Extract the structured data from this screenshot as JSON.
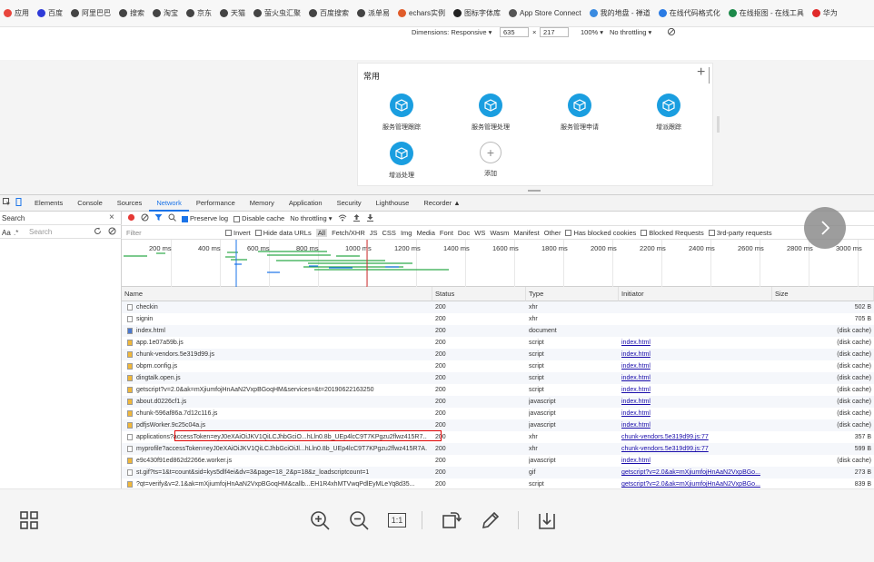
{
  "bookmarks": [
    {
      "label": "应用",
      "icon": "apps-grid-icon",
      "color": "#e8453c"
    },
    {
      "label": "百度",
      "icon": "baidu-paw-icon",
      "color": "#2f3bd8"
    },
    {
      "label": "阿里巴巴",
      "icon": "globe-icon",
      "color": "#444444"
    },
    {
      "label": "搜索",
      "icon": "globe-icon",
      "color": "#444444"
    },
    {
      "label": "淘宝",
      "icon": "globe-icon",
      "color": "#444444"
    },
    {
      "label": "京东",
      "icon": "globe-icon",
      "color": "#444444"
    },
    {
      "label": "天猫",
      "icon": "globe-icon",
      "color": "#444444"
    },
    {
      "label": "萤火虫汇聚",
      "icon": "globe-icon",
      "color": "#444444"
    },
    {
      "label": "百度搜索",
      "icon": "globe-icon",
      "color": "#444444"
    },
    {
      "label": "派单易",
      "icon": "globe-icon",
      "color": "#444444"
    },
    {
      "label": "echars实例",
      "icon": "echarts-icon",
      "color": "#e05c2a"
    },
    {
      "label": "图标字体库",
      "icon": "iconfont-icon",
      "color": "#222222"
    },
    {
      "label": "App Store Connect",
      "icon": "apple-icon",
      "color": "#555555"
    },
    {
      "label": "我的地盘 - 禅道",
      "icon": "zentao-icon",
      "color": "#3a8be0"
    },
    {
      "label": "在线代码格式化",
      "icon": "code-format-icon",
      "color": "#2a7be4"
    },
    {
      "label": "在线抠图 - 在线工具",
      "icon": "tool-icon",
      "color": "#1d8a4a"
    },
    {
      "label": "华为",
      "icon": "huawei-icon",
      "color": "#e02a2a"
    }
  ],
  "device": {
    "dimensions_label": "Dimensions: Responsive ▾",
    "width": "635",
    "times": "×",
    "height": "217",
    "zoom": "100% ▾",
    "throttle": "No throttling ▾"
  },
  "card": {
    "title": "常用",
    "add_symbol": "+",
    "apps": [
      {
        "label": "服务管理跟踪"
      },
      {
        "label": "服务管理处理"
      },
      {
        "label": "服务管理申请"
      },
      {
        "label": "增派跟踪"
      },
      {
        "label": "增派处理"
      }
    ],
    "add_label": "添加"
  },
  "devtools": {
    "tabs": [
      "Elements",
      "Console",
      "Sources",
      "Network",
      "Performance",
      "Memory",
      "Application",
      "Security",
      "Lighthouse",
      "Recorder ▲"
    ],
    "active_tab": "Network",
    "search_label": "Search",
    "search_placeholder": "Search",
    "aa_label": "Aa",
    "regex_label": ".*",
    "preserve_log": "Preserve log",
    "disable_cache": "Disable cache",
    "throttling": "No throttling ▾",
    "filter_placeholder": "Filter",
    "invert": "Invert",
    "hide_data_urls": "Hide data URLs",
    "type_filters": [
      "All",
      "Fetch/XHR",
      "JS",
      "CSS",
      "Img",
      "Media",
      "Font",
      "Doc",
      "WS",
      "Wasm",
      "Manifest",
      "Other"
    ],
    "blocked_cookies": "Has blocked cookies",
    "blocked_requests": "Blocked Requests",
    "third_party": "3rd-party requests",
    "timeline_ticks": [
      "200 ms",
      "400 ms",
      "600 ms",
      "800 ms",
      "1000 ms",
      "1200 ms",
      "1400 ms",
      "1600 ms",
      "1800 ms",
      "2000 ms",
      "2200 ms",
      "2400 ms",
      "2600 ms",
      "2800 ms",
      "3000 ms"
    ],
    "columns": [
      "Name",
      "Status",
      "Type",
      "Initiator",
      "Size"
    ],
    "requests": [
      {
        "name": "checkin",
        "status": "200",
        "type": "xhr",
        "initiator": "",
        "size": "502 B"
      },
      {
        "name": "signin",
        "status": "200",
        "type": "xhr",
        "initiator": "",
        "size": "705 B"
      },
      {
        "name": "index.html",
        "status": "200",
        "type": "document",
        "initiator": "",
        "size": "(disk cache)"
      },
      {
        "name": "app.1e07a59b.js",
        "status": "200",
        "type": "script",
        "initiator": "index.html",
        "size": "(disk cache)"
      },
      {
        "name": "chunk-vendors.5e319d99.js",
        "status": "200",
        "type": "script",
        "initiator": "index.html",
        "size": "(disk cache)"
      },
      {
        "name": "obpm.config.js",
        "status": "200",
        "type": "script",
        "initiator": "index.html",
        "size": "(disk cache)"
      },
      {
        "name": "dingtalk.open.js",
        "status": "200",
        "type": "script",
        "initiator": "index.html",
        "size": "(disk cache)"
      },
      {
        "name": "getscript?v=2.0&ak=mXjiumfojHnAaN2VxpBGoqHM&services=&t=20190622163250",
        "status": "200",
        "type": "script",
        "initiator": "index.html",
        "size": "(disk cache)"
      },
      {
        "name": "about.d0226cf1.js",
        "status": "200",
        "type": "javascript",
        "initiator": "index.html",
        "size": "(disk cache)"
      },
      {
        "name": "chunk-596af86a.7d12c116.js",
        "status": "200",
        "type": "javascript",
        "initiator": "index.html",
        "size": "(disk cache)"
      },
      {
        "name": "pdfjsWorker.9c25c04a.js",
        "status": "200",
        "type": "javascript",
        "initiator": "index.html",
        "size": "(disk cache)"
      },
      {
        "name": "applications?accessToken=eyJ0eXAiOiJKV1QiLCJhbGciO...hLln0.8b_UEp4lcC9T7KPgzu2flwz415R7...",
        "status": "200",
        "type": "xhr",
        "initiator": "chunk-vendors.5e319d99.js:77",
        "size": "357 B"
      },
      {
        "name": "myprofile?accessToken=eyJ0eXAiOiJKV1QiLCJhbGciOiJl...hLln0.8b_UEp4lcC9T7KPgzu2flwz415R7A...",
        "status": "200",
        "type": "xhr",
        "initiator": "chunk-vendors.5e319d99.js:77",
        "size": "599 B"
      },
      {
        "name": "e9c430f91ed862d2266e.worker.js",
        "status": "200",
        "type": "javascript",
        "initiator": "index.html",
        "size": "(disk cache)"
      },
      {
        "name": "st.gif?ts=1&t=count&sid=kys5dlf4ei&dv=3&page=18_2&p=18&z_loadscriptcount=1",
        "status": "200",
        "type": "gif",
        "initiator": "getscript?v=2.0&ak=mXjiumfojHnAaN2VxpBGo...",
        "size": "273 B"
      },
      {
        "name": "?qt=verify&v=2.1&ak=mXjiumfojHnAaN2VxpBGoqHM&callb...EH1R4xhMTVwqPdlEyMLeYq8d35...",
        "status": "200",
        "type": "script",
        "initiator": "getscript?v=2.0&ak=mXjiumfojHnAaN2VxpBGo...",
        "size": "839 B"
      }
    ]
  },
  "viewer": {
    "grid_icon": "grid-view-icon",
    "zoom_in_icon": "zoom-in-icon",
    "zoom_out_icon": "zoom-out-icon",
    "actual_size_label": "1:1",
    "rotate_icon": "rotate-icon",
    "edit_icon": "pencil-icon",
    "download_icon": "download-icon"
  },
  "colors": {
    "accent": "#1a73e8",
    "cube": "#1a9ee0",
    "highlight_box": "#e00000"
  }
}
